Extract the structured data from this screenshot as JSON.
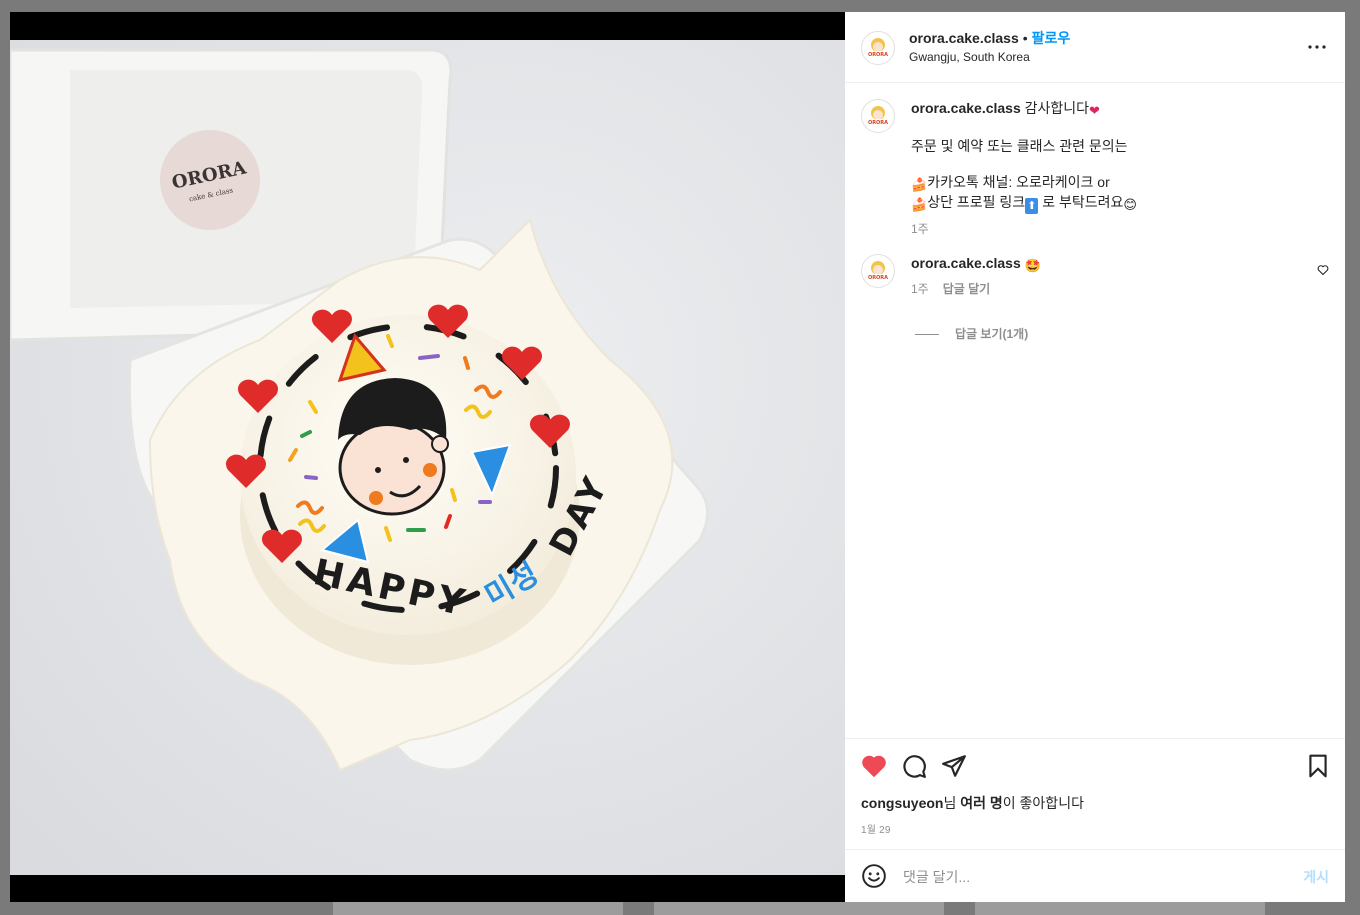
{
  "post": {
    "username": "orora.cake.class",
    "separator": "•",
    "follow_label": "팔로우",
    "location": "Gwangju, South Korea",
    "box_logo_text": "ORORA",
    "box_logo_sub": "cake & class",
    "avatar_text": "ORORA",
    "cake_text_happy": "HAPPY",
    "cake_text_name": "미성",
    "cake_text_day": "DAY"
  },
  "caption": {
    "username": "orora.cake.class",
    "text_first": "감사합니다",
    "text_first_emoji": "❤",
    "line2": "주문 및 예약 또는 클래스 관련 문의는",
    "line3_emoji": "🍰",
    "line3": "카카오톡 채널: 오로라케이크   or",
    "line4_emoji": "🍰",
    "line4": "상단 프로필 링크",
    "line4_emoji2": "⬆",
    "line4_rest": " 로 부탁드려요",
    "line4_emoji3": "😊",
    "time": "1주"
  },
  "comment": {
    "username": "orora.cake.class",
    "emoji": "🤩",
    "time": "1주",
    "reply_label": "답글 달기",
    "view_replies": "답글 보기(1개)"
  },
  "actions": {
    "liked": true,
    "like_color": "#ed4956",
    "liker": "congsuyeon",
    "likes_text_1": "님 ",
    "likes_bold": "여러 명",
    "likes_text_2": "이 좋아합니다",
    "date": "1월 29"
  },
  "comment_box": {
    "placeholder": "댓글 달기...",
    "post_label": "게시"
  },
  "icons": {
    "more": "more-horizontal-icon",
    "heart": "heart-icon",
    "comment": "comment-icon",
    "share": "paper-plane-icon",
    "save": "bookmark-icon",
    "emoji": "emoji-smile-icon"
  }
}
